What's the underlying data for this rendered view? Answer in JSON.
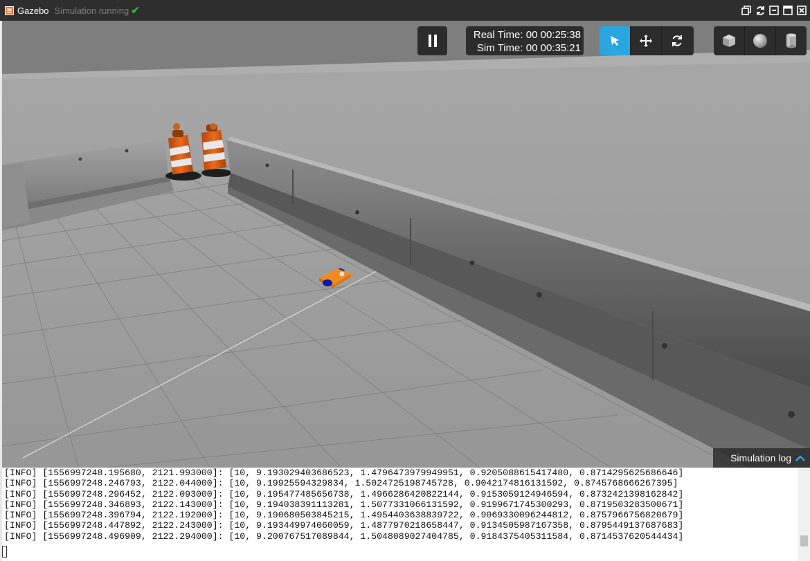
{
  "window": {
    "title": "Gazebo",
    "status": "Simulation running",
    "controls": [
      {
        "name": "restore-icon"
      },
      {
        "name": "refresh-icon"
      },
      {
        "name": "minimize-icon"
      },
      {
        "name": "maximize-icon"
      },
      {
        "name": "close-icon"
      }
    ]
  },
  "toolbar": {
    "pause_icon": "pause-icon",
    "real_time_label": "Real Time:",
    "real_time": "00 00:25:38",
    "sim_time_label": "Sim Time:",
    "sim_time": "00 00:35:21",
    "modes": [
      {
        "name": "select-mode",
        "icon": "cursor-icon",
        "active": true
      },
      {
        "name": "translate-mode",
        "icon": "move-icon",
        "active": false
      },
      {
        "name": "rotate-mode",
        "icon": "rotate-icon",
        "active": false
      }
    ],
    "shapes": [
      {
        "name": "box",
        "icon": "box-icon"
      },
      {
        "name": "sphere",
        "icon": "sphere-icon"
      },
      {
        "name": "cylinder",
        "icon": "cylinder-icon"
      }
    ],
    "accent_color": "#2aa7e0"
  },
  "scene": {
    "objects": [
      "concrete-barrier",
      "traffic-barrel",
      "traffic-barrel",
      "mobile-robot"
    ],
    "robot_color": "#f28a1e",
    "wheel_color": "#0a1aa8"
  },
  "log": {
    "header": "Simulation log",
    "lines": [
      "[INFO] [1556997248.195680, 2121.993000]: [10, 9.193029403686523, 1.4796473979949951, 0.9205088615417480, 0.8714295625686646]",
      "[INFO] [1556997248.246793, 2122.044000]: [10, 9.19925594329834, 1.5024725198745728, 0.9042174816131592, 0.8745768666267395]",
      "[INFO] [1556997248.296452, 2122.093000]: [10, 9.195477485656738, 1.4966286420822144, 0.9153059124946594, 0.8732421398162842]",
      "[INFO] [1556997248.346893, 2122.143000]: [10, 9.194038391113281, 1.5077331066131592, 0.9199671745300293, 0.8719503283500671]",
      "[INFO] [1556997248.396794, 2122.192000]: [10, 9.190680503845215, 1.4954403638839722, 0.9069330096244812, 0.8757966756820679]",
      "[INFO] [1556997248.447892, 2122.243000]: [10, 9.193449974060059, 1.4877970218658447, 0.9134505987167358, 0.8795449137687683]",
      "[INFO] [1556997248.496909, 2122.294000]: [10, 9.200767517089844, 1.5048089027404785, 0.9184375405311584, 0.8714537620544434]"
    ]
  }
}
